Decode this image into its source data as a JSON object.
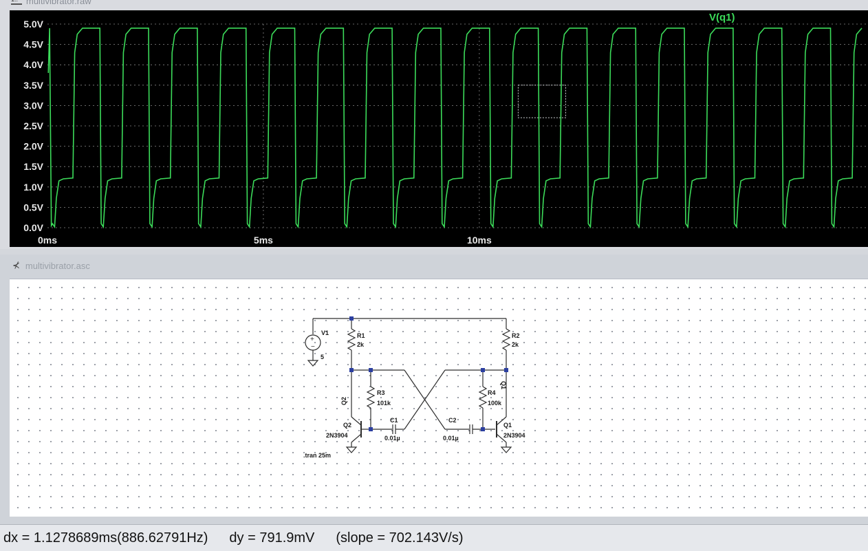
{
  "waveform_window": {
    "title": "multivibrator.raw",
    "trace_label": "V(q1)",
    "trace_color": "#3cdc5a",
    "background": "#000000"
  },
  "chart_data": {
    "type": "line",
    "title": "",
    "xlabel": "",
    "ylabel": "",
    "x_unit": "ms",
    "xlim": [
      0,
      19.0
    ],
    "ylim": [
      0,
      5.0
    ],
    "x_ticks": [
      "0ms",
      "5ms",
      "10ms"
    ],
    "x_tick_values": [
      0,
      5,
      10
    ],
    "y_ticks": [
      "0.0V",
      "0.5V",
      "1.0V",
      "1.5V",
      "2.0V",
      "2.5V",
      "3.0V",
      "3.5V",
      "4.0V",
      "4.5V",
      "5.0V"
    ],
    "y_tick_values": [
      0,
      0.5,
      1.0,
      1.5,
      2.0,
      2.5,
      3.0,
      3.5,
      4.0,
      4.5,
      5.0
    ],
    "grid": true,
    "series": [
      {
        "name": "V(q1)",
        "shape": "square wave rising from ~0V through a ~1.2V step to ~4.9V",
        "period_ms": 1.1278689,
        "high_v": 4.9,
        "step_v": 1.2,
        "low_v": 0.0,
        "first_rise_ms": 0.65
      }
    ],
    "cursor_box": {
      "x": [
        10.9,
        12.0
      ],
      "y": [
        2.7,
        3.5
      ]
    }
  },
  "schematic_window": {
    "title": "multivibrator.asc",
    "components": {
      "V1": {
        "name": "V1",
        "value": "5"
      },
      "R1": {
        "name": "R1",
        "value": "2k"
      },
      "R2": {
        "name": "R2",
        "value": "2k"
      },
      "R3": {
        "name": "R3",
        "value": "101k"
      },
      "R4": {
        "name": "R4",
        "value": "100k"
      },
      "C1": {
        "name": "C1",
        "value": "0.01µ"
      },
      "C2": {
        "name": "C2",
        "value": "0.01µ"
      },
      "Q1": {
        "name": "Q1",
        "model": "2N3904",
        "net_label": "Q1"
      },
      "Q2": {
        "name": "Q2",
        "model": "2N3904",
        "net_label": "Q2"
      }
    },
    "directive": ".tran 25m"
  },
  "status_bar": {
    "dx": "dx = 1.1278689ms(886.62791Hz)",
    "dy": "dy = 791.9mV",
    "slope": "(slope = 702.143V/s)"
  }
}
